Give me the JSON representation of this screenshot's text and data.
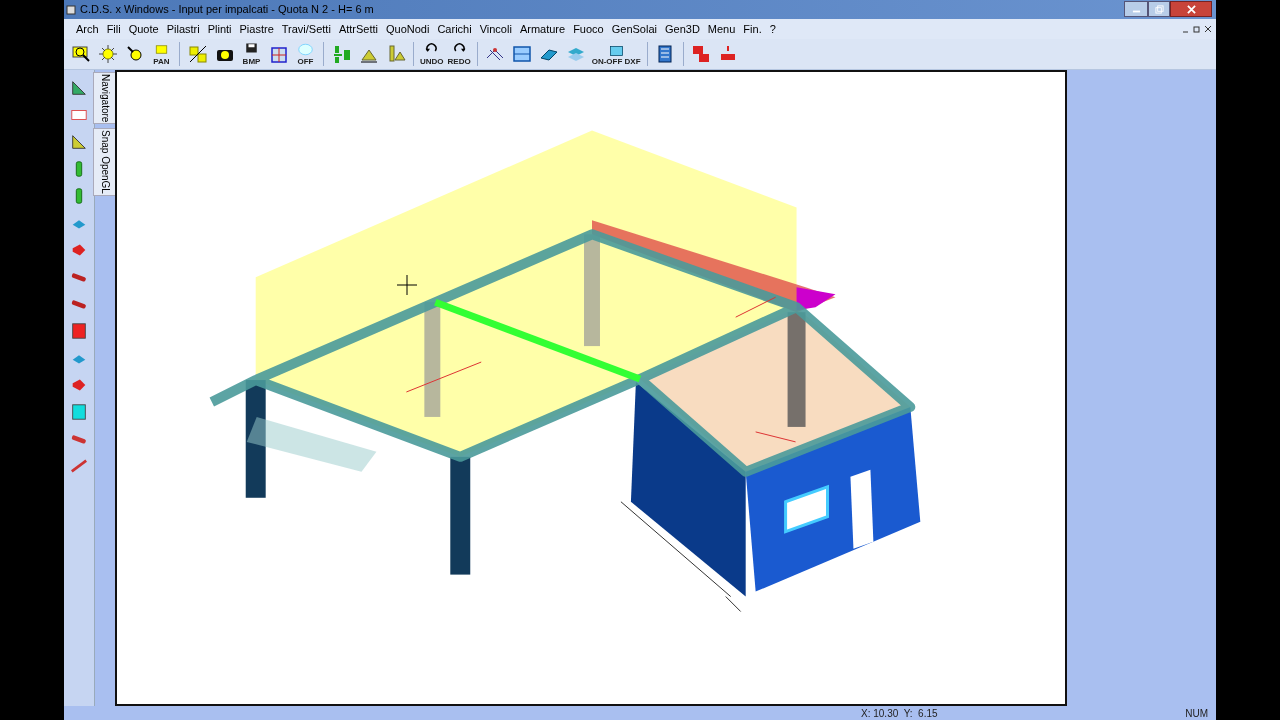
{
  "window": {
    "title": "C.D.S. x Windows - Input per impalcati - Quota N 2 - H= 6 m"
  },
  "menu": [
    {
      "label": "Arch"
    },
    {
      "label": "Fili"
    },
    {
      "label": "Quote"
    },
    {
      "label": "Pilastri"
    },
    {
      "label": "Plinti"
    },
    {
      "label": "Piastre"
    },
    {
      "label": "Travi/Setti"
    },
    {
      "label": "AttrSetti"
    },
    {
      "label": "QuoNodi"
    },
    {
      "label": "Carichi"
    },
    {
      "label": "Vincoli"
    },
    {
      "label": "Armature"
    },
    {
      "label": "Fuoco"
    },
    {
      "label": "GenSolai"
    },
    {
      "label": "Gen3D"
    },
    {
      "label": "Menu"
    },
    {
      "label": "Fin."
    },
    {
      "label": "?"
    }
  ],
  "toolbar": [
    {
      "kind": "button"
    },
    {
      "kind": "button"
    },
    {
      "kind": "button"
    },
    {
      "kind": "button",
      "caption": "PAN"
    },
    {
      "kind": "separator"
    },
    {
      "kind": "button"
    },
    {
      "kind": "button"
    },
    {
      "kind": "button",
      "caption": "BMP"
    },
    {
      "kind": "button"
    },
    {
      "kind": "button",
      "caption": "OFF"
    },
    {
      "kind": "separator"
    },
    {
      "kind": "button"
    },
    {
      "kind": "button"
    },
    {
      "kind": "button"
    },
    {
      "kind": "separator"
    },
    {
      "kind": "button",
      "caption": "UNDO"
    },
    {
      "kind": "button",
      "caption": "REDO"
    },
    {
      "kind": "separator"
    },
    {
      "kind": "button"
    },
    {
      "kind": "button"
    },
    {
      "kind": "button"
    },
    {
      "kind": "button"
    },
    {
      "kind": "button",
      "caption": "ON-OFF DXF"
    },
    {
      "kind": "separator"
    },
    {
      "kind": "button"
    },
    {
      "kind": "separator"
    },
    {
      "kind": "button"
    },
    {
      "kind": "button"
    }
  ],
  "side_tabs": [
    {
      "label": "Navigatore"
    },
    {
      "label": "Snap OpenGL"
    }
  ],
  "status_bar": {
    "coordinates": "X: 10.30  Y:  6.15",
    "num": "NUM"
  }
}
